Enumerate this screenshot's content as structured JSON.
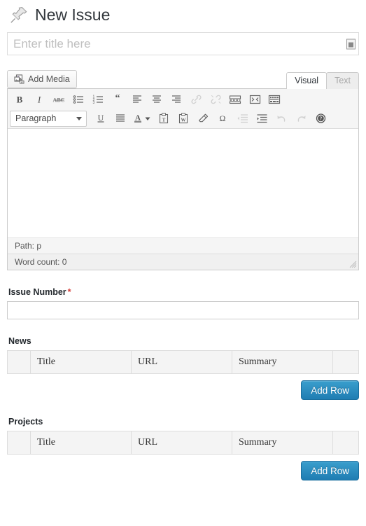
{
  "header": {
    "title": "New Issue",
    "icon": "pushpin-icon"
  },
  "title_field": {
    "placeholder": "Enter title here",
    "value": "",
    "autofill_icon": "form-autofill-icon"
  },
  "editor": {
    "add_media_label": "Add Media",
    "add_media_icon": "media-images-icon",
    "tabs": [
      {
        "label": "Visual",
        "active": true
      },
      {
        "label": "Text",
        "active": false
      }
    ],
    "toolbar_row1": [
      {
        "name": "bold-icon",
        "title": "Bold",
        "disabled": false
      },
      {
        "name": "italic-icon",
        "title": "Italic",
        "disabled": false
      },
      {
        "name": "strikethrough-icon",
        "title": "Strikethrough",
        "disabled": false
      },
      {
        "name": "bulleted-list-icon",
        "title": "Unordered list",
        "disabled": false
      },
      {
        "name": "numbered-list-icon",
        "title": "Ordered list",
        "disabled": false
      },
      {
        "name": "blockquote-icon",
        "title": "Blockquote",
        "disabled": false
      },
      {
        "name": "align-left-icon",
        "title": "Align left",
        "disabled": false
      },
      {
        "name": "align-center-icon",
        "title": "Align center",
        "disabled": false
      },
      {
        "name": "align-right-icon",
        "title": "Align right",
        "disabled": false
      },
      {
        "name": "insert-link-icon",
        "title": "Insert/edit link",
        "disabled": true
      },
      {
        "name": "unlink-icon",
        "title": "Unlink",
        "disabled": true
      },
      {
        "name": "insert-more-tag-icon",
        "title": "Insert Read More tag",
        "disabled": false
      },
      {
        "name": "fullscreen-icon",
        "title": "Distraction-free writing mode",
        "disabled": false
      },
      {
        "name": "kitchen-sink-icon",
        "title": "Toolbar Toggle",
        "disabled": false
      }
    ],
    "format_select": {
      "value": "Paragraph",
      "chevron": "chevron-down-icon"
    },
    "toolbar_row2": [
      {
        "name": "underline-icon",
        "title": "Underline",
        "disabled": false
      },
      {
        "name": "align-justify-icon",
        "title": "Justify",
        "disabled": false
      },
      {
        "name": "text-color-icon",
        "title": "Text color",
        "disabled": false
      },
      {
        "name": "paste-as-text-icon",
        "title": "Paste as text",
        "disabled": false
      },
      {
        "name": "paste-from-word-icon",
        "title": "Paste from Word",
        "disabled": false
      },
      {
        "name": "clear-formatting-icon",
        "title": "Clear formatting",
        "disabled": false
      },
      {
        "name": "special-character-icon",
        "title": "Special character",
        "disabled": false
      },
      {
        "name": "outdent-icon",
        "title": "Decrease indent",
        "disabled": true
      },
      {
        "name": "indent-icon",
        "title": "Increase indent",
        "disabled": false
      },
      {
        "name": "undo-icon",
        "title": "Undo",
        "disabled": true
      },
      {
        "name": "redo-icon",
        "title": "Redo",
        "disabled": true
      },
      {
        "name": "help-icon",
        "title": "Keyboard Shortcuts",
        "disabled": false
      }
    ],
    "content": "",
    "status_path": "Path: p",
    "word_count": "Word count: 0",
    "resize_handle_icon": "resize-grip-icon"
  },
  "issue_number": {
    "label": "Issue Number",
    "required_marker": "*",
    "value": "",
    "placeholder": ""
  },
  "repeaters": [
    {
      "label": "News",
      "columns": [
        "",
        "Title",
        "URL",
        "Summary",
        ""
      ],
      "rows": [],
      "add_row_label": "Add Row"
    },
    {
      "label": "Projects",
      "columns": [
        "",
        "Title",
        "URL",
        "Summary",
        ""
      ],
      "rows": [],
      "add_row_label": "Add Row"
    }
  ],
  "colors": {
    "accent_button": "#2a8fc4",
    "required_asterisk": "#d43f3a",
    "heading_text": "#32373c"
  }
}
